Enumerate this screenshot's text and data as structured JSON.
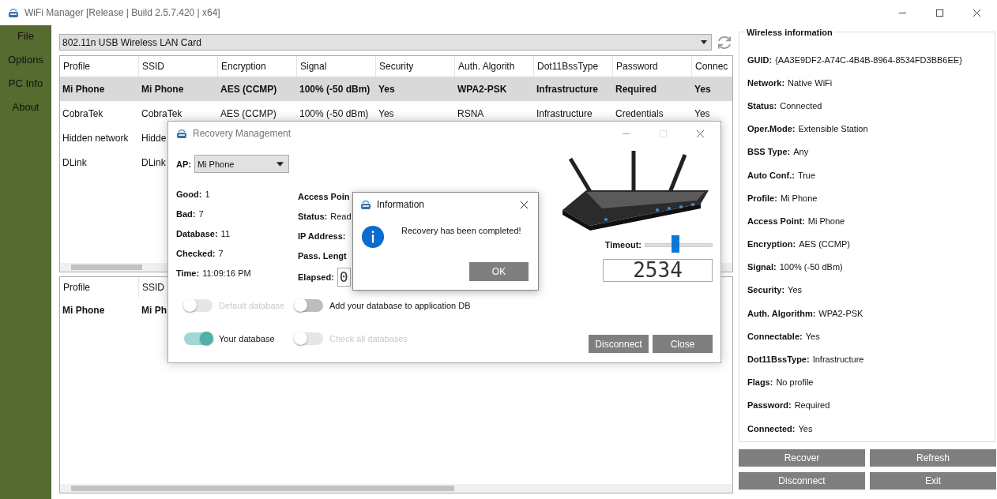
{
  "window": {
    "title": "WiFi Manager [Release | Build 2.5.7.420 | x64]"
  },
  "sidebar": {
    "items": [
      {
        "label": "File"
      },
      {
        "label": "Options"
      },
      {
        "label": "PC Info"
      },
      {
        "label": "About"
      }
    ]
  },
  "adapter": {
    "value": "802.11n USB Wireless LAN Card"
  },
  "networks": {
    "columns": [
      "Profile",
      "SSID",
      "Encryption",
      "Signal",
      "Security",
      "Auth. Algorith",
      "Dot11BssType",
      "Password",
      "Connec"
    ],
    "rows": [
      {
        "selected": true,
        "cells": [
          "Mi Phone",
          "Mi Phone",
          "AES (CCMP)",
          "100% (-50 dBm)",
          "Yes",
          "WPA2-PSK",
          "Infrastructure",
          "Required",
          "Yes"
        ]
      },
      {
        "selected": false,
        "cells": [
          "CobraTek",
          "CobraTek",
          "AES (CCMP)",
          "100% (-50 dBm)",
          "Yes",
          "RSNA",
          "Infrastructure",
          "Credentials",
          "Yes"
        ]
      },
      {
        "selected": false,
        "cells": [
          "Hidden network",
          "Hidde"
        ]
      },
      {
        "selected": false,
        "cells": [
          "DLink",
          "DLink"
        ]
      }
    ]
  },
  "connected_table": {
    "columns": [
      "Profile",
      "SSID"
    ],
    "rows": [
      {
        "cells": [
          "Mi Phone",
          "Mi Ph"
        ]
      }
    ]
  },
  "wireless_info": {
    "title": "Wireless information",
    "fields": [
      {
        "label": "GUID:",
        "value": "{AA3E9DF2-A74C-4B4B-8964-8534FD3BB6EE}"
      },
      {
        "label": "Network:",
        "value": "Native WiFi"
      },
      {
        "label": "Status:",
        "value": "Connected"
      },
      {
        "label": "Oper.Mode:",
        "value": "Extensible Station"
      },
      {
        "label": "BSS Type:",
        "value": "Any"
      },
      {
        "label": "Auto Conf.:",
        "value": "True"
      },
      {
        "label": "Profile:",
        "value": "Mi Phone"
      },
      {
        "label": "Access Point:",
        "value": "Mi Phone"
      },
      {
        "label": "Encryption:",
        "value": "AES (CCMP)"
      },
      {
        "label": "Signal:",
        "value": "100% (-50 dBm)"
      },
      {
        "label": "Security:",
        "value": "Yes"
      },
      {
        "label": "Auth. Algorithm:",
        "value": "WPA2-PSK"
      },
      {
        "label": "Connectable:",
        "value": "Yes"
      },
      {
        "label": "Dot11BssType:",
        "value": "Infrastructure"
      },
      {
        "label": "Flags:",
        "value": "No profile"
      },
      {
        "label": "Password:",
        "value": "Required"
      },
      {
        "label": "Connected:",
        "value": "Yes"
      }
    ]
  },
  "buttons": [
    {
      "label": "Recover"
    },
    {
      "label": "Refresh"
    },
    {
      "label": "Disconnect"
    },
    {
      "label": "Exit"
    }
  ],
  "recovery_dialog": {
    "title": "Recovery Management",
    "ap": {
      "label": "AP:",
      "value": "Mi Phone"
    },
    "stats": [
      {
        "label": "Good:",
        "value": "1"
      },
      {
        "label": "Bad:",
        "value": "7"
      },
      {
        "label": "Database:",
        "value": "11"
      },
      {
        "label": "Checked:",
        "value": "7"
      },
      {
        "label": "Time:",
        "value": "11:09:16 PM"
      }
    ],
    "details": [
      {
        "kind": "text",
        "label": "Access Poin"
      },
      {
        "kind": "text",
        "label": "Status:",
        "value": "Read"
      },
      {
        "kind": "text",
        "label": "IP Address:"
      },
      {
        "kind": "text",
        "label": "Pass. Lengt"
      },
      {
        "kind": "display",
        "label": "Elapsed:",
        "value": "0"
      }
    ],
    "timeout": {
      "label": "Timeout:",
      "level": 0.45
    },
    "counter": "2534",
    "switches": [
      {
        "label": "Default database",
        "on": false,
        "disabled": true
      },
      {
        "label": "Add your database to application DB",
        "on": false,
        "disabled": false
      },
      {
        "label": "Your database",
        "on": true,
        "disabled": false
      },
      {
        "label": "Check all databases",
        "on": false,
        "disabled": true
      }
    ],
    "buttons": [
      "Disconnect",
      "Close"
    ]
  },
  "info_dialog": {
    "title": "Information",
    "message": "Recovery has been completed!",
    "button": "OK"
  }
}
